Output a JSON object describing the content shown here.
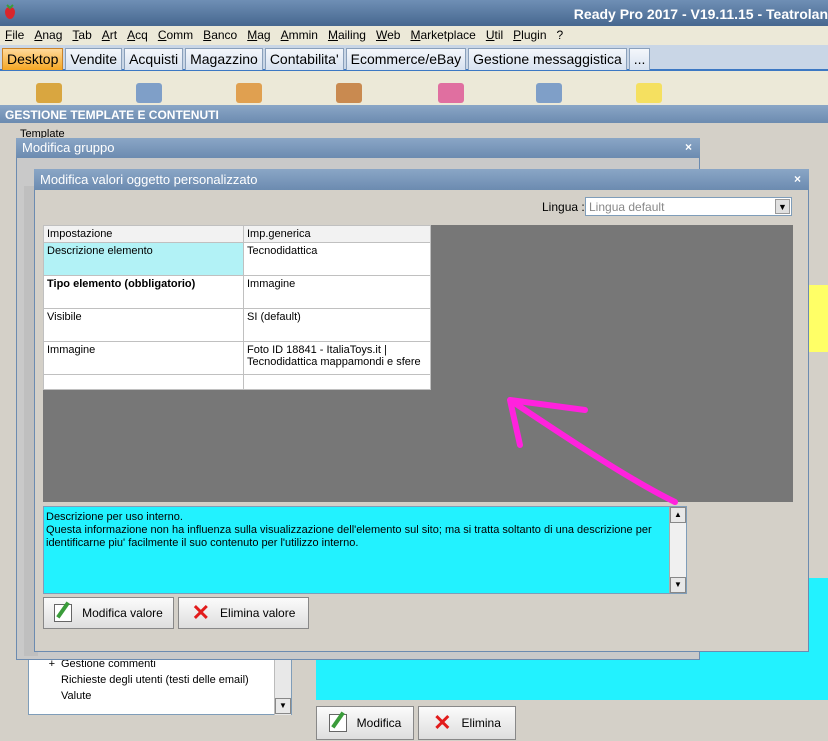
{
  "app": {
    "title": "Ready Pro 2017 - V19.11.15 - Teatrolan"
  },
  "menu": [
    "File",
    "Anag",
    "Tab",
    "Art",
    "Acq",
    "Comm",
    "Banco",
    "Mag",
    "Ammin",
    "Mailing",
    "Web",
    "Marketplace",
    "Util",
    "Plugin",
    "?"
  ],
  "tabs": [
    "Desktop",
    "Vendite",
    "Acquisti",
    "Magazzino",
    "Contabilita'",
    "Ecommerce/eBay",
    "Gestione messaggistica",
    "..."
  ],
  "gestione": {
    "title": "GESTIONE TEMPLATE E CONTENUTI",
    "template_label": "Template"
  },
  "gruppo_dialog": {
    "title": "Modifica gruppo",
    "close": "×"
  },
  "main_dialog": {
    "title": "Modifica valori oggetto personalizzato",
    "close": "×",
    "lingua_label": "Lingua :",
    "lingua_value": "Lingua default",
    "table": {
      "headers": [
        "Impostazione",
        "Imp.generica"
      ],
      "rows": [
        {
          "label": "Descrizione elemento",
          "value": "Tecnodidattica"
        },
        {
          "label": "Tipo elemento (obbligatorio)",
          "value": "Immagine"
        },
        {
          "label": "Visibile",
          "value": "SI (default)"
        },
        {
          "label": "Immagine",
          "value": "Foto ID 18841 - ItaliaToys.it | Tecnodidattica mappamondi e sfere"
        }
      ]
    },
    "description": {
      "line1": "Descrizione per uso interno.",
      "line2": "Questa informazione non ha influenza sulla visualizzazione dell'elemento sul sito; ma si tratta soltanto di una descrizione per identificarne piu' facilmente il suo contenuto per l'utilizzo interno."
    },
    "buttons": {
      "modifica_valore": "Modifica valore",
      "elimina_valore": "Elimina valore"
    }
  },
  "tree": {
    "items": [
      "Gestione commenti",
      "Richieste degli utenti (testi delle email)",
      "Valute"
    ]
  },
  "bottom_buttons": {
    "modifica": "Modifica",
    "elimina": "Elimina"
  },
  "annotation": {
    "arrow_color": "#ff22dd"
  }
}
